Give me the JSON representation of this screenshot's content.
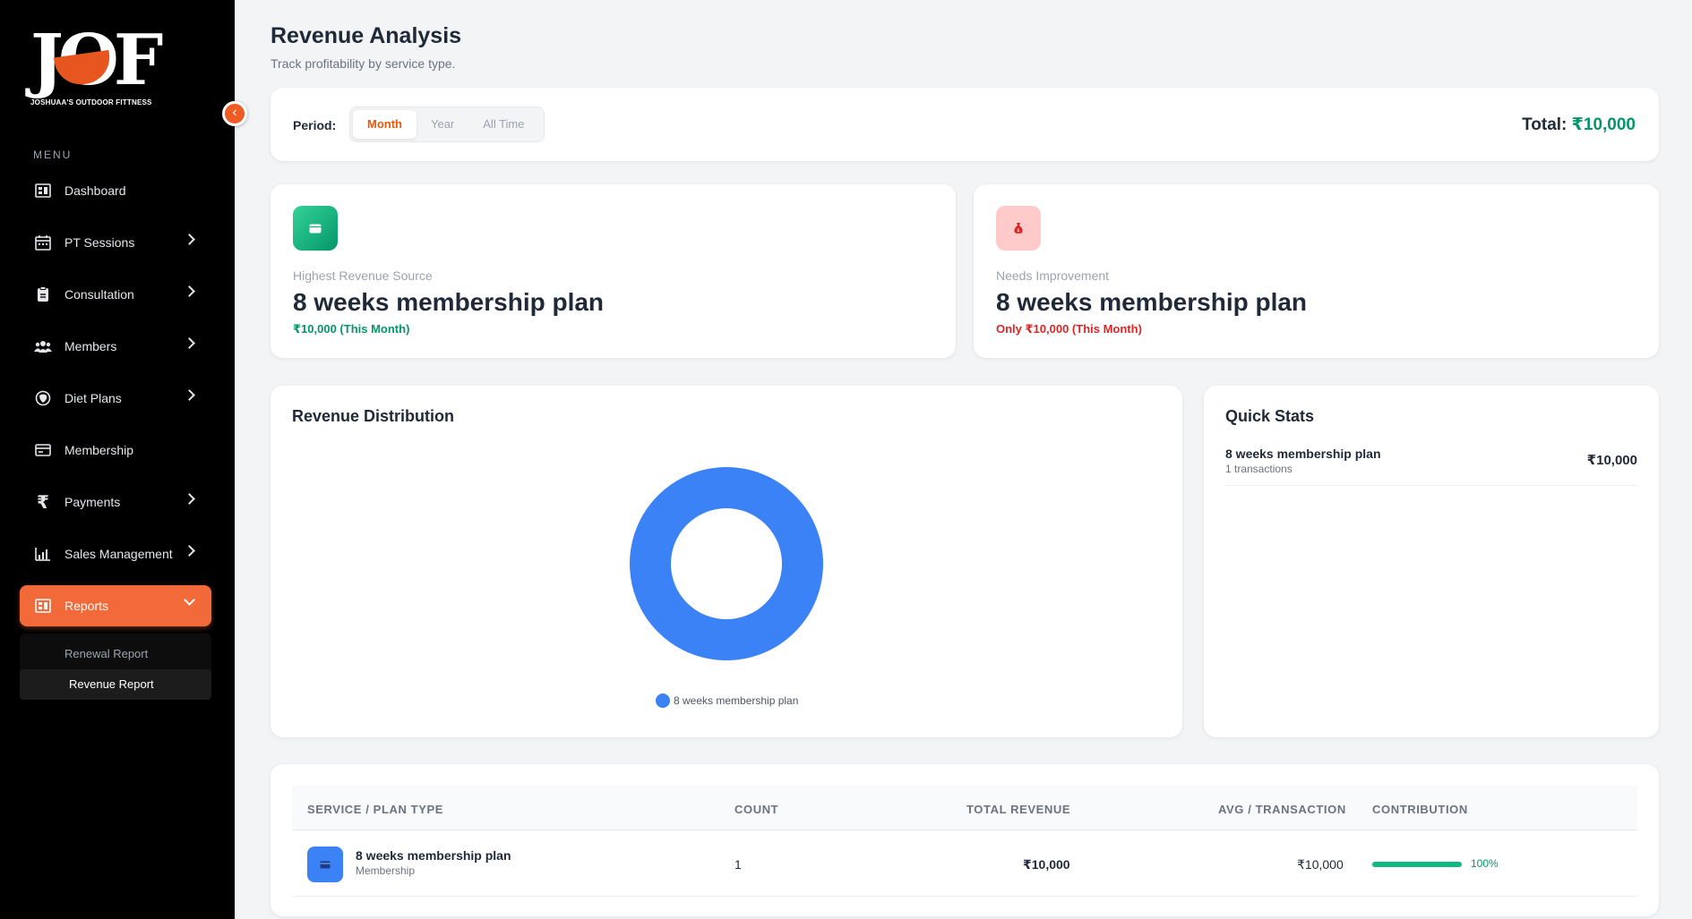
{
  "brand": {
    "logo_text": "JOF",
    "tagline": "JOSHUAA'S OUTDOOR FITTNESS",
    "accent": "#f26a3a"
  },
  "sidebar": {
    "menu_label": "MENU",
    "items": [
      {
        "label": "Dashboard",
        "icon": "dashboard-icon",
        "has_children": false
      },
      {
        "label": "PT Sessions",
        "icon": "calendar-icon",
        "has_children": true
      },
      {
        "label": "Consultation",
        "icon": "clipboard-icon",
        "has_children": true
      },
      {
        "label": "Members",
        "icon": "users-icon",
        "has_children": true
      },
      {
        "label": "Diet Plans",
        "icon": "diet-icon",
        "has_children": true
      },
      {
        "label": "Membership",
        "icon": "card-icon",
        "has_children": false
      },
      {
        "label": "Payments",
        "icon": "rupee-icon",
        "has_children": true
      },
      {
        "label": "Sales Management",
        "icon": "chart-icon",
        "has_children": true
      },
      {
        "label": "Reports",
        "icon": "report-icon",
        "has_children": true,
        "active": true
      }
    ],
    "sub_items": [
      {
        "label": "Renewal Report"
      },
      {
        "label": "Revenue Report",
        "active": true
      }
    ]
  },
  "header": {
    "title": "Revenue Analysis",
    "subtitle": "Track profitability by service type."
  },
  "period": {
    "label": "Period:",
    "options": [
      "Month",
      "Year",
      "All Time"
    ],
    "selected": "Month",
    "total_label": "Total:",
    "total_value": "₹10,000"
  },
  "highest": {
    "label": "Highest Revenue Source",
    "value": "8 weeks membership plan",
    "note": "₹10,000 (This Month)",
    "color": "#059669"
  },
  "improvement": {
    "label": "Needs Improvement",
    "value": "8 weeks membership plan",
    "note": "Only ₹10,000 (This Month)",
    "color": "#dc2626"
  },
  "distribution": {
    "title": "Revenue Distribution"
  },
  "chart_data": {
    "type": "pie",
    "categories": [
      "8 weeks membership plan"
    ],
    "values": [
      10000
    ],
    "colors": [
      "#3b82f6"
    ],
    "title": "Revenue Distribution",
    "legend": "bottom"
  },
  "quick_stats": {
    "title": "Quick Stats",
    "rows": [
      {
        "name": "8 weeks membership plan",
        "sub": "1 transactions",
        "value": "₹10,000"
      }
    ]
  },
  "table": {
    "headers": [
      "SERVICE / PLAN TYPE",
      "COUNT",
      "TOTAL REVENUE",
      "AVG / TRANSACTION",
      "CONTRIBUTION"
    ],
    "rows": [
      {
        "name": "8 weeks membership plan",
        "category": "Membership",
        "count": "1",
        "total": "₹10,000",
        "avg": "₹10,000",
        "contribution": "100%",
        "contribution_value": 100
      }
    ]
  }
}
